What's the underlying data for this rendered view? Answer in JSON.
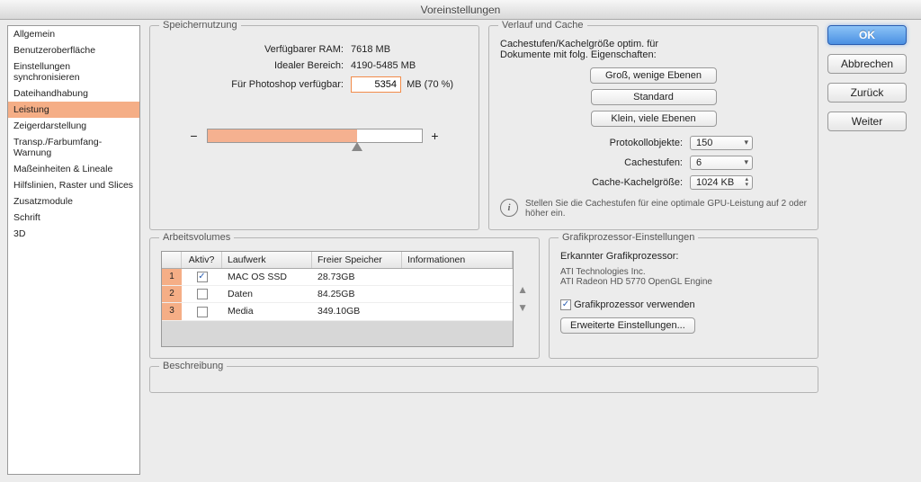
{
  "title": "Voreinstellungen",
  "sidebar": {
    "items": [
      "Allgemein",
      "Benutzeroberfläche",
      "Einstellungen synchronisieren",
      "Dateihandhabung",
      "Leistung",
      "Zeigerdarstellung",
      "Transp./Farbumfang-Warnung",
      "Maßeinheiten & Lineale",
      "Hilfslinien, Raster und Slices",
      "Zusatzmodule",
      "Schrift",
      "3D"
    ],
    "selected_index": 4
  },
  "memory": {
    "legend": "Speichernutzung",
    "available_label": "Verfügbarer RAM:",
    "available_value": "7618 MB",
    "ideal_label": "Idealer Bereich:",
    "ideal_value": "4190-5485 MB",
    "let_label": "Für Photoshop verfügbar:",
    "let_value": "5354",
    "let_suffix": "MB (70 %)",
    "minus": "−",
    "plus": "+"
  },
  "history": {
    "legend": "Verlauf und Cache",
    "subtitle1": "Cachestufen/Kachelgröße optim. für",
    "subtitle2": "Dokumente mit folg. Eigenschaften:",
    "btn_tall": "Groß, wenige Ebenen",
    "btn_default": "Standard",
    "btn_short": "Klein, viele Ebenen",
    "proto_label": "Protokollobjekte:",
    "proto_value": "150",
    "levels_label": "Cachestufen:",
    "levels_value": "6",
    "tile_label": "Cache-Kachelgröße:",
    "tile_value": "1024 KB",
    "hint": "Stellen Sie die Cachestufen für eine optimale GPU-Leistung auf 2 oder höher ein."
  },
  "scratch": {
    "legend": "Arbeitsvolumes",
    "headers": [
      "",
      "Aktiv?",
      "Laufwerk",
      "Freier Speicher",
      "Informationen"
    ],
    "rows": [
      {
        "n": "1",
        "active": true,
        "drive": "MAC OS SSD",
        "free": "28.73GB",
        "info": ""
      },
      {
        "n": "2",
        "active": false,
        "drive": "Daten",
        "free": "84.25GB",
        "info": ""
      },
      {
        "n": "3",
        "active": false,
        "drive": "Media",
        "free": "349.10GB",
        "info": ""
      }
    ]
  },
  "gpu": {
    "legend": "Grafikprozessor-Einstellungen",
    "detected_label": "Erkannter Grafikprozessor:",
    "vendor": "ATI Technologies Inc.",
    "device": "ATI Radeon HD 5770 OpenGL Engine",
    "use_label": "Grafikprozessor verwenden",
    "use_checked": true,
    "adv_btn": "Erweiterte Einstellungen..."
  },
  "desc": {
    "legend": "Beschreibung"
  },
  "buttons": {
    "ok": "OK",
    "cancel": "Abbrechen",
    "prev": "Zurück",
    "next": "Weiter"
  }
}
